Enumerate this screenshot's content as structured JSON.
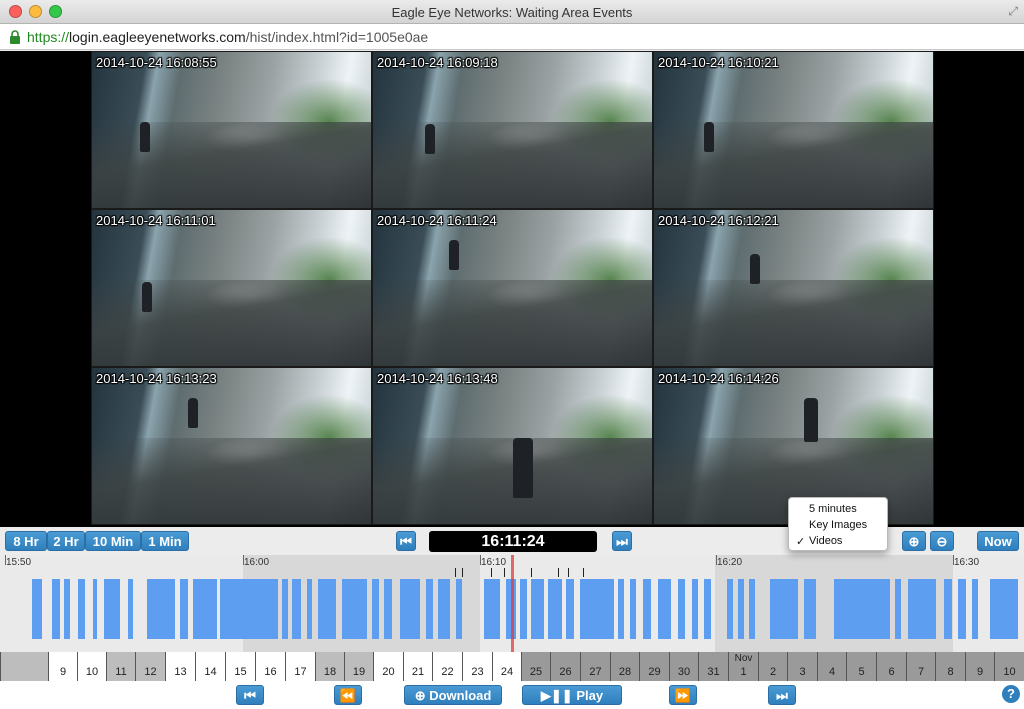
{
  "window": {
    "title": "Eagle Eye Networks: Waiting Area Events"
  },
  "url": {
    "scheme": "https://",
    "host": "login.eagleeyenetworks.com",
    "path": "/hist/index.html?id=1005e0ae"
  },
  "cameras": [
    {
      "timestamp": "2014-10-24 16:08:55"
    },
    {
      "timestamp": "2014-10-24 16:09:18"
    },
    {
      "timestamp": "2014-10-24 16:10:21"
    },
    {
      "timestamp": "2014-10-24 16:11:01"
    },
    {
      "timestamp": "2014-10-24 16:11:24"
    },
    {
      "timestamp": "2014-10-24 16:12:21"
    },
    {
      "timestamp": "2014-10-24 16:13:23"
    },
    {
      "timestamp": "2014-10-24 16:13:48"
    },
    {
      "timestamp": "2014-10-24 16:14:26"
    }
  ],
  "controls": {
    "range_8hr": "8 Hr",
    "range_2hr": "2 Hr",
    "range_10min": "10 Min",
    "range_1min": "1 Min",
    "current_time": "16:11:24",
    "now_label": "Now"
  },
  "view_menu": {
    "items": [
      "5 minutes",
      "Key Images",
      "Videos"
    ],
    "selected": "Videos",
    "checkmark": "✓"
  },
  "timeline": {
    "ticks": [
      "15:50",
      "16:00",
      "16:10",
      "16:20",
      "16:30"
    ]
  },
  "days": {
    "month_label": "Nov",
    "labels": [
      "9",
      "10",
      "11",
      "12",
      "13",
      "14",
      "15",
      "16",
      "17",
      "18",
      "19",
      "20",
      "21",
      "22",
      "23",
      "24",
      "25",
      "26",
      "27",
      "28",
      "29",
      "30",
      "31",
      "1",
      "2",
      "3",
      "4",
      "5",
      "6",
      "7",
      "8",
      "9",
      "10"
    ]
  },
  "bottom": {
    "download_label": "Download",
    "play_label": "Play",
    "help_label": "?"
  }
}
